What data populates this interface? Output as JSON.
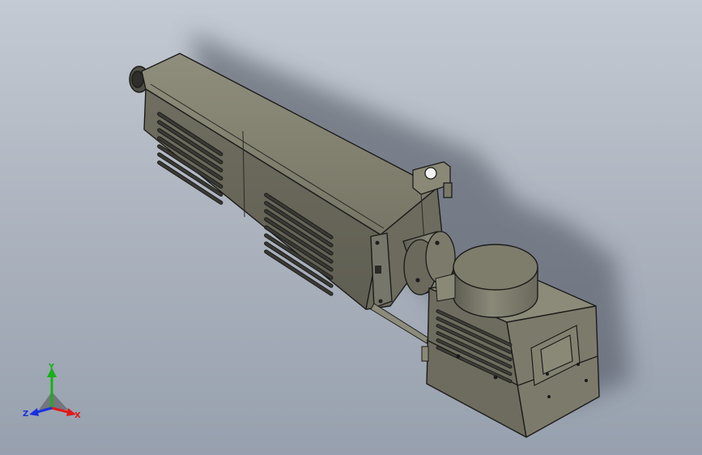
{
  "viewport": {
    "background_top": "#c4cad3",
    "background_bottom": "#97a0ae"
  },
  "triad": {
    "x_label": "X",
    "y_label": "Y",
    "z_label": "Z",
    "x_color": "#e01818",
    "y_color": "#18b018",
    "z_color": "#1830e0"
  },
  "model": {
    "body_color": "#7c7b6b",
    "body_light": "#9a9987",
    "body_dark": "#55544a",
    "edge_color": "#1c1c1a"
  }
}
